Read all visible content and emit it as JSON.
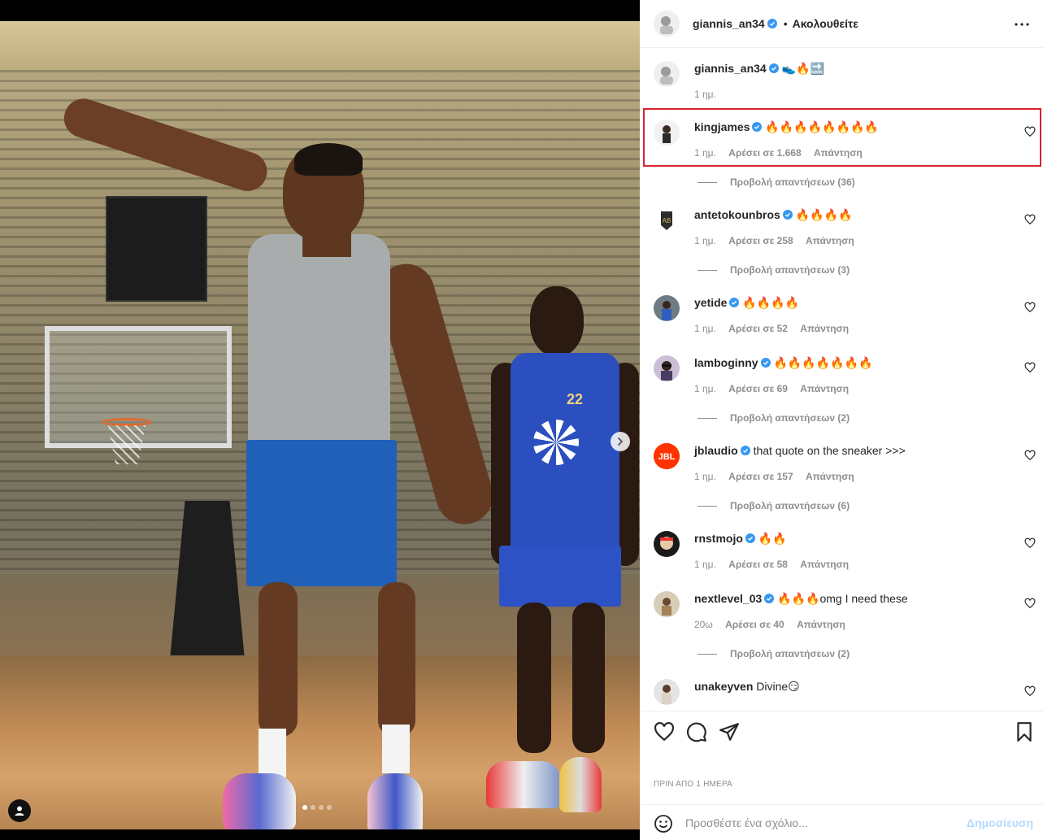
{
  "header": {
    "username": "giannis_an34",
    "separator": "•",
    "follow_label": "Ακολουθείτε"
  },
  "caption": {
    "username": "giannis_an34",
    "text": "👟🔥🔜",
    "time": "1 ημ."
  },
  "comments": [
    {
      "username": "kingjames",
      "text": "🔥🔥🔥🔥🔥🔥🔥🔥",
      "time": "1 ημ.",
      "likes": "Αρέσει σε 1.668",
      "reply": "Απάντηση",
      "view_replies": "Προβολή απαντήσεων (36)"
    },
    {
      "username": "antetokounbros",
      "text": "🔥🔥🔥🔥",
      "time": "1 ημ.",
      "likes": "Αρέσει σε 258",
      "reply": "Απάντηση",
      "view_replies": "Προβολή απαντήσεων (3)"
    },
    {
      "username": "yetide",
      "text": "🔥🔥🔥🔥",
      "time": "1 ημ.",
      "likes": "Αρέσει σε 52",
      "reply": "Απάντηση"
    },
    {
      "username": "lamboginny",
      "text": "🔥🔥🔥🔥🔥🔥🔥",
      "time": "1 ημ.",
      "likes": "Αρέσει σε 69",
      "reply": "Απάντηση",
      "view_replies": "Προβολή απαντήσεων (2)"
    },
    {
      "username": "jblaudio",
      "text": "that quote on the sneaker >>>",
      "time": "1 ημ.",
      "likes": "Αρέσει σε 157",
      "reply": "Απάντηση",
      "view_replies": "Προβολή απαντήσεων (6)"
    },
    {
      "username": "rnstmojo",
      "text": "🔥🔥",
      "time": "1 ημ.",
      "likes": "Αρέσει σε 58",
      "reply": "Απάντηση"
    },
    {
      "username": "nextlevel_03",
      "text": "🔥🔥🔥omg I need these",
      "time": "20ω",
      "likes": "Αρέσει σε 40",
      "reply": "Απάντηση",
      "view_replies": "Προβολή απαντήσεων (2)"
    },
    {
      "username": "unakeyven",
      "text": "Divine😏"
    }
  ],
  "post_timestamp": "ΠΡΙΝ ΑΠΟ 1 ΗΜΕΡΑ",
  "add_comment": {
    "placeholder": "Προσθέστε ένα σχόλιο...",
    "post_label": "Δημοσίευση"
  },
  "carousel": {
    "slides": 4,
    "active": 1
  },
  "player_jersey_number": "22",
  "colors": {
    "verified": "#3897f0",
    "highlight": "#d9232e",
    "post_disabled": "#b3dbff",
    "secondary_text": "#8e8e8e"
  },
  "icons": [
    "more-options-icon",
    "verified-icon",
    "heart-icon",
    "comment-icon",
    "share-icon",
    "bookmark-icon",
    "emoji-icon",
    "next-arrow-icon",
    "tag-user-icon"
  ]
}
